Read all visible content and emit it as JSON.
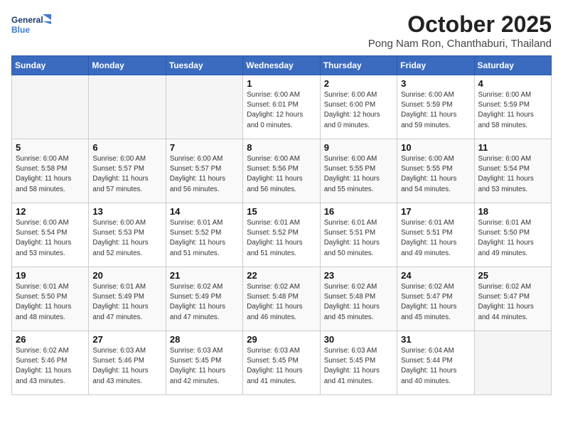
{
  "header": {
    "logo_line1": "General",
    "logo_line2": "Blue",
    "month": "October 2025",
    "location": "Pong Nam Ron, Chanthaburi, Thailand"
  },
  "weekdays": [
    "Sunday",
    "Monday",
    "Tuesday",
    "Wednesday",
    "Thursday",
    "Friday",
    "Saturday"
  ],
  "weeks": [
    [
      {
        "day": "",
        "info": ""
      },
      {
        "day": "",
        "info": ""
      },
      {
        "day": "",
        "info": ""
      },
      {
        "day": "1",
        "info": "Sunrise: 6:00 AM\nSunset: 6:01 PM\nDaylight: 12 hours\nand 0 minutes."
      },
      {
        "day": "2",
        "info": "Sunrise: 6:00 AM\nSunset: 6:00 PM\nDaylight: 12 hours\nand 0 minutes."
      },
      {
        "day": "3",
        "info": "Sunrise: 6:00 AM\nSunset: 5:59 PM\nDaylight: 11 hours\nand 59 minutes."
      },
      {
        "day": "4",
        "info": "Sunrise: 6:00 AM\nSunset: 5:59 PM\nDaylight: 11 hours\nand 58 minutes."
      }
    ],
    [
      {
        "day": "5",
        "info": "Sunrise: 6:00 AM\nSunset: 5:58 PM\nDaylight: 11 hours\nand 58 minutes."
      },
      {
        "day": "6",
        "info": "Sunrise: 6:00 AM\nSunset: 5:57 PM\nDaylight: 11 hours\nand 57 minutes."
      },
      {
        "day": "7",
        "info": "Sunrise: 6:00 AM\nSunset: 5:57 PM\nDaylight: 11 hours\nand 56 minutes."
      },
      {
        "day": "8",
        "info": "Sunrise: 6:00 AM\nSunset: 5:56 PM\nDaylight: 11 hours\nand 56 minutes."
      },
      {
        "day": "9",
        "info": "Sunrise: 6:00 AM\nSunset: 5:55 PM\nDaylight: 11 hours\nand 55 minutes."
      },
      {
        "day": "10",
        "info": "Sunrise: 6:00 AM\nSunset: 5:55 PM\nDaylight: 11 hours\nand 54 minutes."
      },
      {
        "day": "11",
        "info": "Sunrise: 6:00 AM\nSunset: 5:54 PM\nDaylight: 11 hours\nand 53 minutes."
      }
    ],
    [
      {
        "day": "12",
        "info": "Sunrise: 6:00 AM\nSunset: 5:54 PM\nDaylight: 11 hours\nand 53 minutes."
      },
      {
        "day": "13",
        "info": "Sunrise: 6:00 AM\nSunset: 5:53 PM\nDaylight: 11 hours\nand 52 minutes."
      },
      {
        "day": "14",
        "info": "Sunrise: 6:01 AM\nSunset: 5:52 PM\nDaylight: 11 hours\nand 51 minutes."
      },
      {
        "day": "15",
        "info": "Sunrise: 6:01 AM\nSunset: 5:52 PM\nDaylight: 11 hours\nand 51 minutes."
      },
      {
        "day": "16",
        "info": "Sunrise: 6:01 AM\nSunset: 5:51 PM\nDaylight: 11 hours\nand 50 minutes."
      },
      {
        "day": "17",
        "info": "Sunrise: 6:01 AM\nSunset: 5:51 PM\nDaylight: 11 hours\nand 49 minutes."
      },
      {
        "day": "18",
        "info": "Sunrise: 6:01 AM\nSunset: 5:50 PM\nDaylight: 11 hours\nand 49 minutes."
      }
    ],
    [
      {
        "day": "19",
        "info": "Sunrise: 6:01 AM\nSunset: 5:50 PM\nDaylight: 11 hours\nand 48 minutes."
      },
      {
        "day": "20",
        "info": "Sunrise: 6:01 AM\nSunset: 5:49 PM\nDaylight: 11 hours\nand 47 minutes."
      },
      {
        "day": "21",
        "info": "Sunrise: 6:02 AM\nSunset: 5:49 PM\nDaylight: 11 hours\nand 47 minutes."
      },
      {
        "day": "22",
        "info": "Sunrise: 6:02 AM\nSunset: 5:48 PM\nDaylight: 11 hours\nand 46 minutes."
      },
      {
        "day": "23",
        "info": "Sunrise: 6:02 AM\nSunset: 5:48 PM\nDaylight: 11 hours\nand 45 minutes."
      },
      {
        "day": "24",
        "info": "Sunrise: 6:02 AM\nSunset: 5:47 PM\nDaylight: 11 hours\nand 45 minutes."
      },
      {
        "day": "25",
        "info": "Sunrise: 6:02 AM\nSunset: 5:47 PM\nDaylight: 11 hours\nand 44 minutes."
      }
    ],
    [
      {
        "day": "26",
        "info": "Sunrise: 6:02 AM\nSunset: 5:46 PM\nDaylight: 11 hours\nand 43 minutes."
      },
      {
        "day": "27",
        "info": "Sunrise: 6:03 AM\nSunset: 5:46 PM\nDaylight: 11 hours\nand 43 minutes."
      },
      {
        "day": "28",
        "info": "Sunrise: 6:03 AM\nSunset: 5:45 PM\nDaylight: 11 hours\nand 42 minutes."
      },
      {
        "day": "29",
        "info": "Sunrise: 6:03 AM\nSunset: 5:45 PM\nDaylight: 11 hours\nand 41 minutes."
      },
      {
        "day": "30",
        "info": "Sunrise: 6:03 AM\nSunset: 5:45 PM\nDaylight: 11 hours\nand 41 minutes."
      },
      {
        "day": "31",
        "info": "Sunrise: 6:04 AM\nSunset: 5:44 PM\nDaylight: 11 hours\nand 40 minutes."
      },
      {
        "day": "",
        "info": ""
      }
    ]
  ]
}
